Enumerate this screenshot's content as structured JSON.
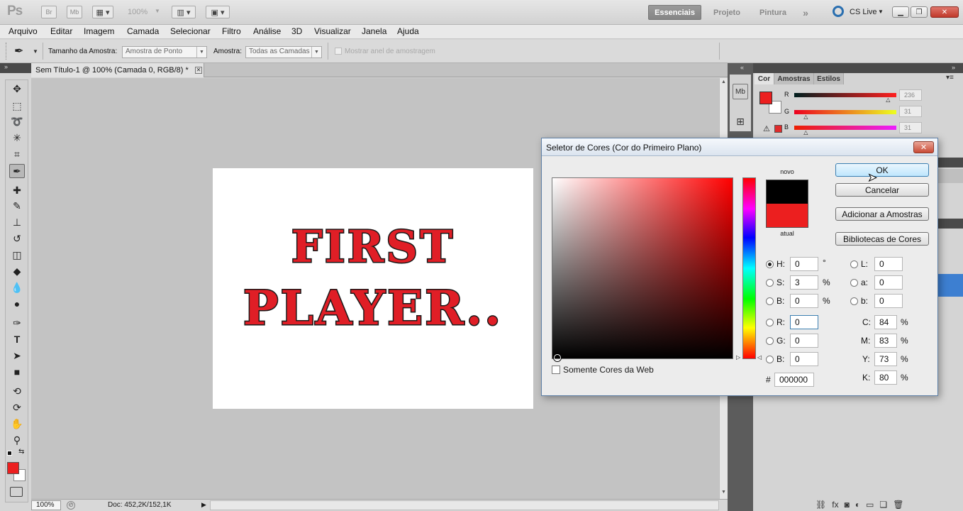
{
  "app": {
    "logo": "Ps",
    "bridge_label": "Br",
    "minibridge_label": "Mb",
    "zoom": "100%",
    "workspaces": [
      {
        "label": "Essenciais",
        "active": true
      },
      {
        "label": "Projeto",
        "active": false
      },
      {
        "label": "Pintura",
        "active": false
      }
    ],
    "more_workspaces": "»",
    "cs_live": "CS Live"
  },
  "menu": [
    "Arquivo",
    "Editar",
    "Imagem",
    "Camada",
    "Selecionar",
    "Filtro",
    "Análise",
    "3D",
    "Visualizar",
    "Janela",
    "Ajuda"
  ],
  "options": {
    "sample_size_label": "Tamanho da Amostra:",
    "sample_size_value": "Amostra de Ponto",
    "sample_label": "Amostra:",
    "sample_value": "Todas as Camadas",
    "show_ring_label": "Mostrar anel de amostragem"
  },
  "document": {
    "tab_title": "Sem Título-1 @ 100% (Camada 0, RGB/8) *",
    "art_line1": "FIRST",
    "art_line2": "PLAYER..",
    "art_color": "#e01e26"
  },
  "status": {
    "zoom": "100%",
    "doc_info": "Doc: 452,2K/152,1K"
  },
  "color_panel": {
    "tabs": [
      {
        "label": "Cor",
        "active": true
      },
      {
        "label": "Amostras",
        "active": false
      },
      {
        "label": "Estilos",
        "active": false
      }
    ],
    "channels": [
      {
        "label": "R",
        "value": "236",
        "level": 0.925
      },
      {
        "label": "G",
        "value": "31",
        "level": 0.12
      },
      {
        "label": "B",
        "value": "31",
        "level": 0.12
      }
    ]
  },
  "picker": {
    "title": "Seletor de Cores (Cor do Primeiro Plano)",
    "novo_label": "novo",
    "atual_label": "atual",
    "novo_color": "#000000",
    "atual_color": "#ec1f1f",
    "buttons": {
      "ok": "OK",
      "cancel": "Cancelar",
      "add_swatches": "Adicionar a Amostras",
      "libraries": "Bibliotecas de Cores"
    },
    "web_only_label": "Somente Cores da Web",
    "hsb": {
      "h_label": "H:",
      "h": "0",
      "h_unit": "°",
      "s_label": "S:",
      "s": "3",
      "s_unit": "%",
      "b_label": "B:",
      "b": "0",
      "b_unit": "%"
    },
    "rgb": {
      "r_label": "R:",
      "r": "0",
      "g_label": "G:",
      "g": "0",
      "b_label": "B:",
      "b": "0"
    },
    "lab": {
      "l_label": "L:",
      "l": "0",
      "a_label": "a:",
      "a": "0",
      "b_label": "b:",
      "b": "0"
    },
    "cmyk": {
      "c_label": "C:",
      "c": "84",
      "m_label": "M:",
      "m": "83",
      "y_label": "Y:",
      "y": "73",
      "k_label": "K:",
      "k": "80",
      "unit": "%"
    },
    "hex_label": "#",
    "hex": "000000"
  }
}
